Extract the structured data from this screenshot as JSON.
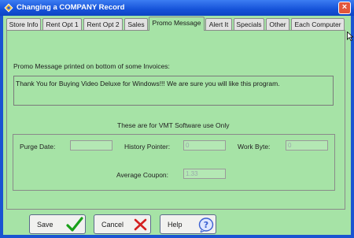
{
  "window": {
    "title": "Changing a COMPANY Record",
    "close_symbol": "×"
  },
  "tabs": [
    {
      "label": "Store Info"
    },
    {
      "label": "Rent Opt 1"
    },
    {
      "label": "Rent Opt 2"
    },
    {
      "label": "Sales"
    },
    {
      "label": "Promo Message",
      "active": true
    },
    {
      "label": "Alert It"
    },
    {
      "label": "Specials"
    },
    {
      "label": "Other"
    },
    {
      "label": "Each Computer"
    }
  ],
  "promo": {
    "label": "Promo Message printed on bottom of some Invoices:",
    "text": "Thank You for Buying Video Deluxe for Windows!!! We are sure you will like this program."
  },
  "vmt": {
    "heading": "These are for VMT Software use Only",
    "purge_date_label": "Purge Date:",
    "purge_date_value": "",
    "history_pointer_label": "History Pointer:",
    "history_pointer_value": "0",
    "work_byte_label": "Work Byte:",
    "work_byte_value": "0",
    "average_coupon_label": "Average Coupon:",
    "average_coupon_value": "1.33"
  },
  "buttons": {
    "save": "Save",
    "cancel": "Cancel",
    "help": "Help"
  },
  "colors": {
    "form_bg": "#a6e3a6",
    "titlebar": "#1552d8",
    "save_check": "#19a019",
    "cancel_x": "#d42020",
    "help_icon": "#3a5fd0"
  }
}
